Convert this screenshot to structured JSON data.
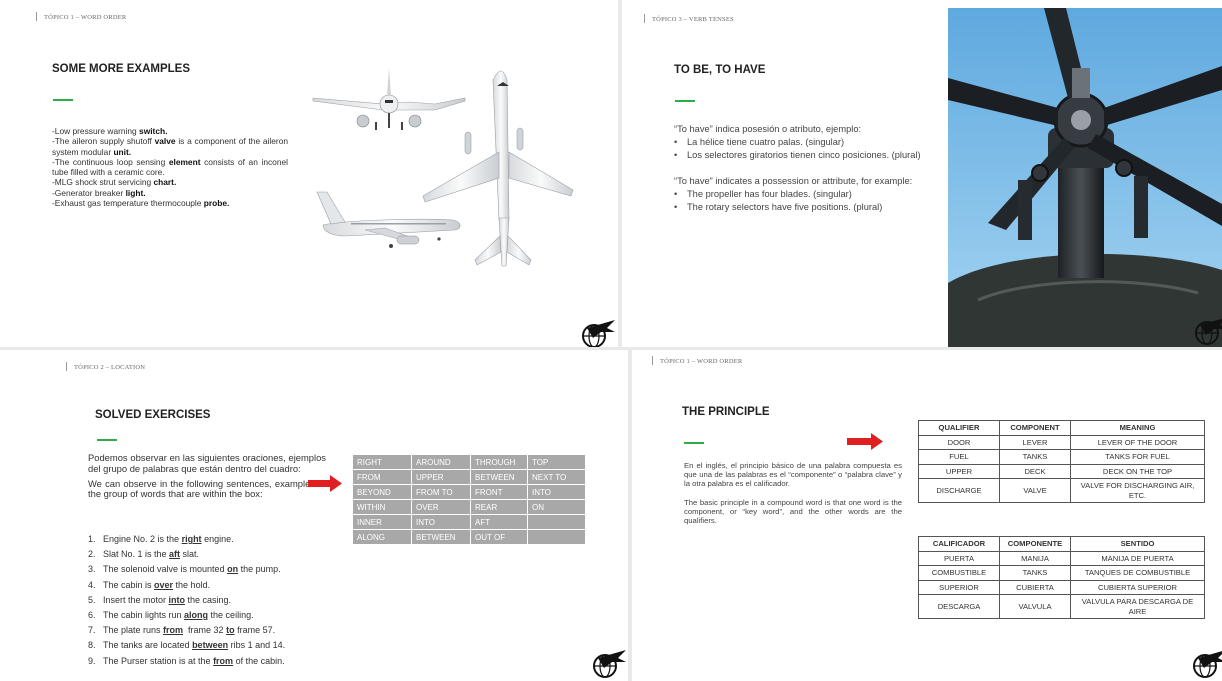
{
  "slide1": {
    "breadcrumb": "TÓPICO 1 – WORD ORDER",
    "title": "SOME MORE EXAMPLES",
    "examples": [
      {
        "pre": "-Low pressure warning ",
        "key": "switch.",
        "post": ""
      },
      {
        "pre": "-The aileron supply shutoff ",
        "key": "valve",
        "post": " is a component of the aileron system modular ",
        "key2": "unit."
      },
      {
        "pre": "-The continuous loop sensing ",
        "key": "element",
        "post": " consists of an inconel tube filled with a ceramic core."
      },
      {
        "pre": "-MLG shock strut servicing ",
        "key": "chart.",
        "post": ""
      },
      {
        "pre": "-Generator breaker ",
        "key": "light.",
        "post": ""
      },
      {
        "pre": "-Exhaust gas temperature thermocouple ",
        "key": "probe.",
        "post": ""
      }
    ]
  },
  "slide2": {
    "breadcrumb": "TÓPICO 3 – VERB TENSES",
    "title": "TO BE, TO HAVE",
    "es_intro": "“To have” indica posesión o atributo, ejemplo:",
    "es_items": [
      "La hélice tiene cuatro palas. (singular)",
      "Los selectores giratorios tienen cinco posiciones. (plural)"
    ],
    "en_intro": "“To have” indicates a possession or attribute, for example:",
    "en_items": [
      "The propeller has four blades. (singular)",
      "The rotary selectors have five positions. (plural)"
    ]
  },
  "slide3": {
    "breadcrumb": "TÓPICO 2 – LOCATION",
    "title": "SOLVED EXERCISES",
    "intro_es": "Podemos observar en las siguientes oraciones, ejemplos del grupo de palabras que están dentro del cuadro:",
    "intro_en": "We can observe in the following sentences, examples of the group of words that are within the box:",
    "grid": [
      [
        "RIGHT",
        "AROUND",
        "THROUGH",
        "TOP"
      ],
      [
        "FROM",
        "UPPER",
        "BETWEEN",
        "NEXT TO"
      ],
      [
        "BEYOND",
        "FROM TO",
        "FRONT",
        "INTO"
      ],
      [
        "WITHIN",
        "OVER",
        "REAR",
        "ON"
      ],
      [
        "INNER",
        "INTO",
        "AFT",
        ""
      ],
      [
        "ALONG",
        "BETWEEN",
        "OUT OF",
        ""
      ]
    ],
    "sentences": [
      {
        "n": "1.",
        "pre": "Engine No. 2 is the ",
        "key": "right",
        "post": " engine."
      },
      {
        "n": "2.",
        "pre": "Slat No. 1 is the ",
        "key": "aft",
        "post": " slat."
      },
      {
        "n": "3.",
        "pre": "The solenoid valve is mounted ",
        "key": "on",
        "post": " the pump."
      },
      {
        "n": "4.",
        "pre": "The cabin is ",
        "key": "over",
        "post": " the hold."
      },
      {
        "n": "5.",
        "pre": "Insert the motor ",
        "key": "into",
        "post": " the casing."
      },
      {
        "n": "6.",
        "pre": "The cabin lights run ",
        "key": "along",
        "post": " the ceiling."
      },
      {
        "n": "7.",
        "pre": "The plate runs ",
        "key": "from",
        "post": "  frame 32 ",
        "key2": "to",
        "post2": " frame 57."
      },
      {
        "n": "8.",
        "pre": "The tanks are located ",
        "key": "between",
        "post": " ribs 1 and 14."
      },
      {
        "n": "9.",
        "pre": "The Purser station is at the ",
        "key": "from",
        "post": " of the cabin."
      }
    ]
  },
  "slide4": {
    "breadcrumb": "TÓPICO 1 – WORD ORDER",
    "title": "THE PRINCIPLE",
    "text_es": "En el inglés, el principio básico de una palabra compuesta es que una de las palabras es el “componente” o “palabra clave” y la otra palabra es el calificador.",
    "text_en": "The basic principle in a compound word is that one word is the component, or “key word”, and the other words are the qualifiers.",
    "table_en": {
      "headers": [
        "QUALIFIER",
        "COMPONENT",
        "MEANING"
      ],
      "rows": [
        [
          "DOOR",
          "LEVER",
          "LEVER OF THE DOOR"
        ],
        [
          "FUEL",
          "TANKS",
          "TANKS FOR FUEL"
        ],
        [
          "UPPER",
          "DECK",
          "DECK ON THE TOP"
        ],
        [
          "DISCHARGE",
          "VALVE",
          "VALVE FOR DISCHARGING AIR, ETC."
        ]
      ]
    },
    "table_es": {
      "headers": [
        "CALIFICADOR",
        "COMPONENTE",
        "SENTIDO"
      ],
      "rows": [
        [
          "PUERTA",
          "MANIJA",
          "MANIJA DE PUERTA"
        ],
        [
          "COMBUSTIBLE",
          "TANKS",
          "TANQUES DE COMBUSTIBLE"
        ],
        [
          "SUPERIOR",
          "CUBIERTA",
          "CUBIERTA SUPERIOR"
        ],
        [
          "DESCARGA",
          "VALVULA",
          "VALVULA PARA DESCARGA DE AIRE"
        ]
      ]
    }
  },
  "colors": {
    "accent": "#2eac4a",
    "arrow": "#e02020",
    "grid": "#a8a8a8",
    "sky": "#7fc0ea"
  },
  "icons": [
    "airplane-illustration-icon",
    "helicopter-rotor-photo",
    "globe-plane-logo-icon",
    "red-arrow-icon"
  ]
}
